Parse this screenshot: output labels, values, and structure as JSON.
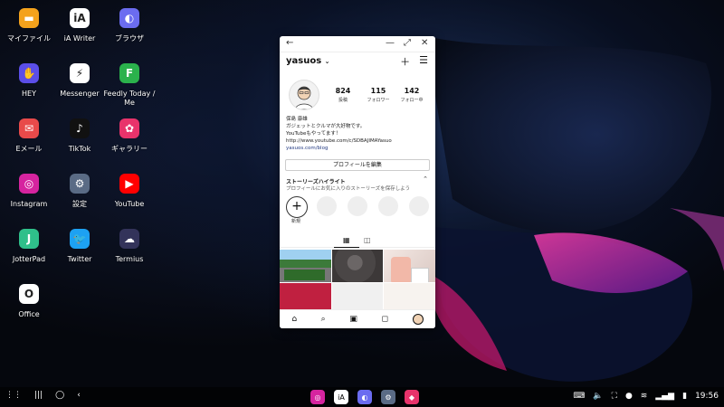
{
  "desktop": {
    "icons": [
      {
        "label": "マイファイル",
        "icon": "folder-icon",
        "color": "#f4a21c"
      },
      {
        "label": "iA Writer",
        "icon": "ia-writer-icon",
        "color": "#ffffff"
      },
      {
        "label": "ブラウザ",
        "icon": "browser-icon",
        "color": "#6b6cf0"
      },
      {
        "label": "HEY",
        "icon": "hey-icon",
        "color": "#5b4ee8"
      },
      {
        "label": "Messenger",
        "icon": "messenger-icon",
        "color": "#ffffff"
      },
      {
        "label": "Feedly Today / Me",
        "icon": "feedly-icon",
        "color": "#2bb24c"
      },
      {
        "label": "Eメール",
        "icon": "email-icon",
        "color": "#e84a4a"
      },
      {
        "label": "TikTok",
        "icon": "tiktok-icon",
        "color": "#111111"
      },
      {
        "label": "ギャラリー",
        "icon": "gallery-icon",
        "color": "#e8336b"
      },
      {
        "label": "Instagram",
        "icon": "instagram-icon",
        "color": "#d6249f"
      },
      {
        "label": "設定",
        "icon": "settings-icon",
        "color": "#5a6b85"
      },
      {
        "label": "YouTube",
        "icon": "youtube-icon",
        "color": "#ff0000"
      },
      {
        "label": "JotterPad",
        "icon": "jotterpad-icon",
        "color": "#2fbf8a"
      },
      {
        "label": "Twitter",
        "icon": "twitter-icon",
        "color": "#1da1f2"
      },
      {
        "label": "Termius",
        "icon": "termius-icon",
        "color": "#33335a"
      },
      {
        "label": "Office",
        "icon": "office-icon",
        "color": "#ffffff"
      }
    ]
  },
  "window": {
    "back_icon": "←",
    "minimize_icon": "—",
    "maximize_icon": "⤢",
    "close_icon": "✕"
  },
  "profile": {
    "username": "yasuos",
    "posts_count": "824",
    "posts_label": "投稿",
    "followers_count": "115",
    "followers_label": "フォロワー",
    "following_count": "142",
    "following_label": "フォロー中",
    "name": "保島 康雄",
    "bio_line1": "ガジェットとクルマが大好物です。",
    "bio_line2": "YouTubeもやってます！",
    "bio_url": "http://www.youtube.com/c/SDBAJIMAYasuo",
    "bio_link": "yasuos.com/blog",
    "edit_button": "プロフィールを編集",
    "highlights_title": "ストーリーズハイライト",
    "highlights_sub": "プロフィールにお気に入りのストーリーズを保存しよう",
    "new_label": "新規"
  },
  "taskbar": {
    "time": "19:56",
    "colors": {
      "instagram": "#d6249f",
      "iawriter": "#ffffff",
      "browser": "#6b6cf0",
      "settings": "#5a6b85",
      "store": "#e8336b"
    }
  }
}
